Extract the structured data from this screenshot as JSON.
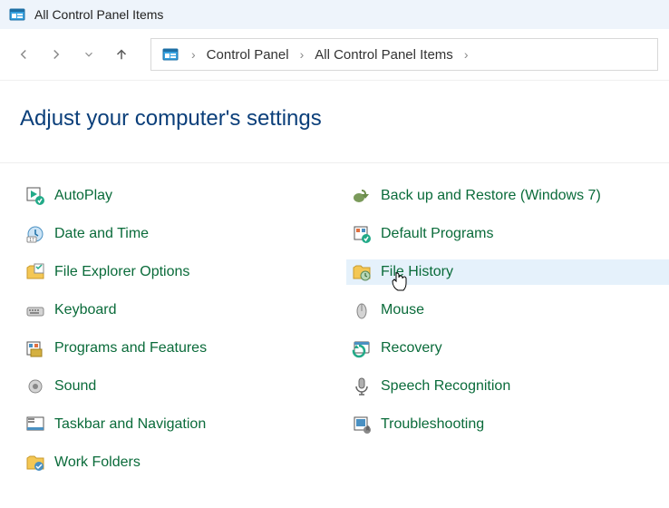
{
  "titlebar": {
    "title": "All Control Panel Items"
  },
  "breadcrumbs": {
    "root": "Control Panel",
    "current": "All Control Panel Items"
  },
  "heading": "Adjust your computer's settings",
  "items": {
    "left": [
      {
        "key": "autoplay",
        "label": "AutoPlay"
      },
      {
        "key": "datetime",
        "label": "Date and Time"
      },
      {
        "key": "explorer",
        "label": "File Explorer Options"
      },
      {
        "key": "keyboard",
        "label": "Keyboard"
      },
      {
        "key": "programs",
        "label": "Programs and Features"
      },
      {
        "key": "sound",
        "label": "Sound"
      },
      {
        "key": "taskbar",
        "label": "Taskbar and Navigation"
      },
      {
        "key": "workfolders",
        "label": "Work Folders"
      }
    ],
    "right": [
      {
        "key": "backup",
        "label": "Back up and Restore (Windows 7)"
      },
      {
        "key": "default",
        "label": "Default Programs"
      },
      {
        "key": "filehistory",
        "label": "File History",
        "hover": true
      },
      {
        "key": "mouse",
        "label": "Mouse"
      },
      {
        "key": "recovery",
        "label": "Recovery"
      },
      {
        "key": "speech",
        "label": "Speech Recognition"
      },
      {
        "key": "troubleshoot",
        "label": "Troubleshooting"
      }
    ]
  },
  "colors": {
    "link": "#0a6b3a",
    "heading": "#0b3f7a",
    "hover": "#e5f1fb"
  }
}
